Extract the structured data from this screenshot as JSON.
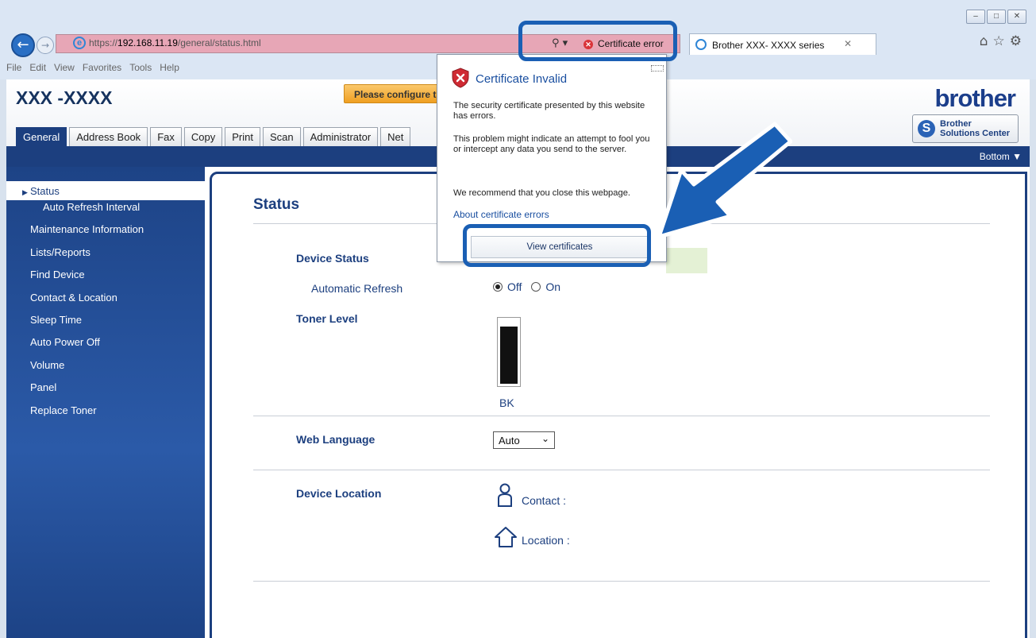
{
  "browser": {
    "url_scheme": "https://",
    "url_host": "192.168.11.19",
    "url_path": "/general/status.html",
    "cert_error_label": "Certificate error",
    "tab_title": "Brother XXX- XXXX    series",
    "menu": [
      "File",
      "Edit",
      "View",
      "Favorites",
      "Tools",
      "Help"
    ],
    "window_controls": [
      "minimize",
      "maximize",
      "close"
    ],
    "toolbar_icons": [
      "home-icon",
      "star-icon",
      "gear-icon"
    ]
  },
  "header": {
    "model": "XXX -XXXX",
    "configure_button": "Please configure th",
    "logo": "brother",
    "solutions_line1": "Brother",
    "solutions_line2": "Solutions Center",
    "bottom_link": "Bottom ▼"
  },
  "tabs": [
    "General",
    "Address Book",
    "Fax",
    "Copy",
    "Print",
    "Scan",
    "Administrator",
    "Net"
  ],
  "sidebar": {
    "items": [
      {
        "label": "Status",
        "active": true
      },
      {
        "label": "Auto Refresh Interval",
        "sub": true
      },
      {
        "label": "Maintenance Information"
      },
      {
        "label": "Lists/Reports"
      },
      {
        "label": "Find Device"
      },
      {
        "label": "Contact & Location"
      },
      {
        "label": "Sleep Time"
      },
      {
        "label": "Auto Power Off"
      },
      {
        "label": "Volume"
      },
      {
        "label": "Panel"
      },
      {
        "label": "Replace Toner"
      }
    ]
  },
  "main": {
    "title": "Status",
    "device_status_label": "Device Status",
    "auto_refresh_label": "Automatic Refresh",
    "refresh_off": "Off",
    "refresh_on": "On",
    "refresh_selected": "Off",
    "toner_label": "Toner Level",
    "toner_color": "BK",
    "toner_level": 0.9,
    "web_language_label": "Web Language",
    "web_language_value": "Auto",
    "device_location_label": "Device Location",
    "contact_label": "Contact :",
    "location_label": "Location :"
  },
  "popup": {
    "title": "Certificate Invalid",
    "p1": "The security certificate presented by this website has errors.",
    "p2": "This problem might indicate an attempt to fool you or intercept any data you send to the server.",
    "p3": "We recommend that you close this webpage.",
    "link": "About certificate errors",
    "button": "View certificates"
  },
  "colors": {
    "brand_navy": "#1c3f7f",
    "cert_error_bar": "#e7a6b6",
    "highlight": "#1a5fb4"
  }
}
